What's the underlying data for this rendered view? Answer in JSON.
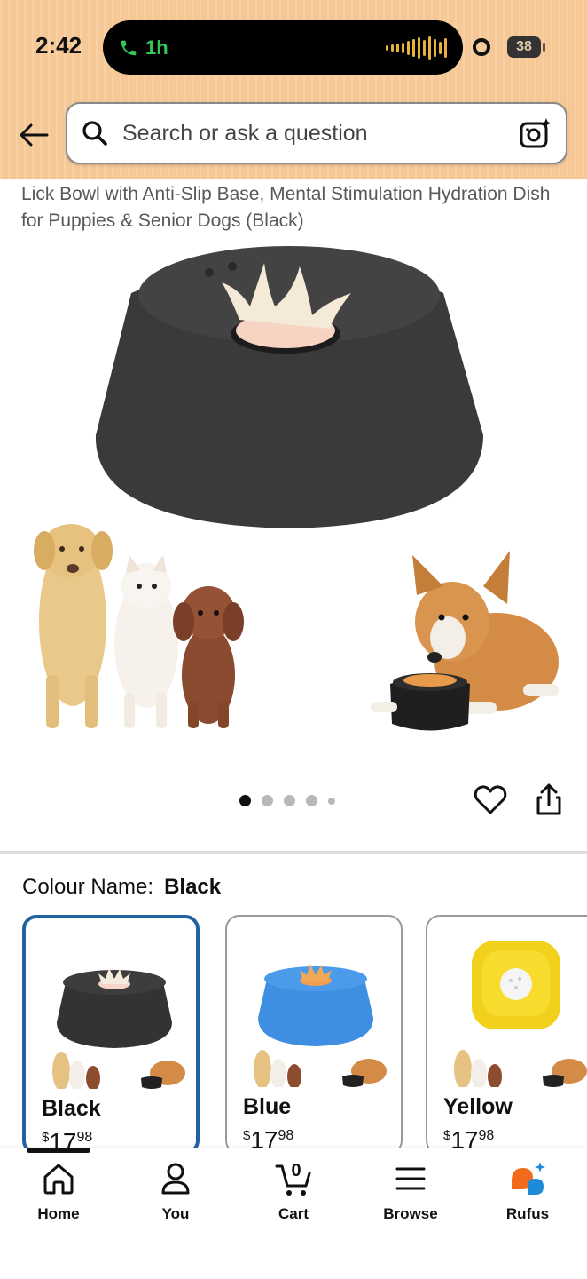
{
  "status_bar": {
    "time": "2:42",
    "call_duration": "1h",
    "battery": "38"
  },
  "search": {
    "placeholder": "Search or ask a question"
  },
  "product": {
    "title": "Lick Bowl with Anti-Slip Base, Mental Stimulation Hydration Dish for Puppies & Senior Dogs (Black)",
    "image_count": 5,
    "active_image": 1
  },
  "colour": {
    "label": "Colour Name:",
    "selected": "Black",
    "options": [
      {
        "name": "Black",
        "currency": "$",
        "whole": "17",
        "fraction": "98",
        "color": "#3a3a3a"
      },
      {
        "name": "Blue",
        "currency": "$",
        "whole": "17",
        "fraction": "98",
        "color": "#3d8fe0"
      },
      {
        "name": "Yellow",
        "currency": "$",
        "whole": "17",
        "fraction": "98",
        "color": "#f0cf1c"
      }
    ]
  },
  "nav": {
    "items": [
      {
        "label": "Home",
        "icon": "home-icon"
      },
      {
        "label": "You",
        "icon": "person-icon"
      },
      {
        "label": "Cart",
        "icon": "cart-icon",
        "count": "0"
      },
      {
        "label": "Browse",
        "icon": "menu-icon"
      },
      {
        "label": "Rufus",
        "icon": "rufus-icon"
      }
    ]
  },
  "colors": {
    "header": "#f5c896",
    "selected_border": "#2162a1",
    "call_green": "#34c759",
    "rufus_orange": "#f26a1b",
    "rufus_blue": "#1f8ad8"
  }
}
